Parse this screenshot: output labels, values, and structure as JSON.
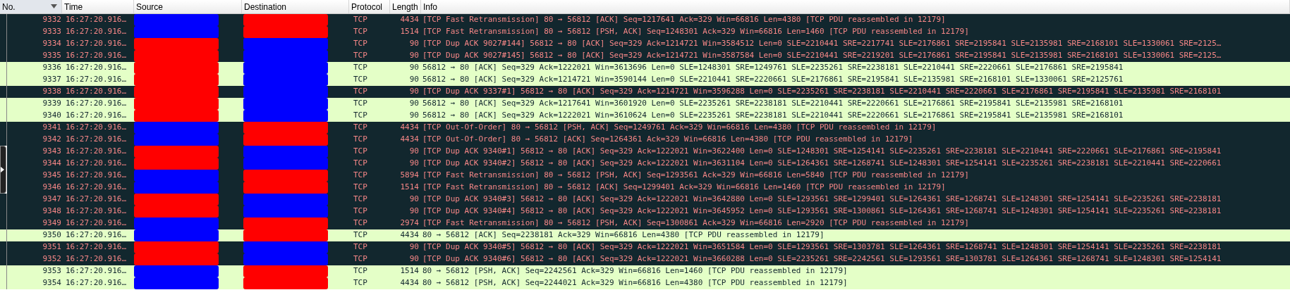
{
  "columns": [
    {
      "label": "No.",
      "sorted": true
    },
    {
      "label": "Time",
      "sorted": false
    },
    {
      "label": "Source",
      "sorted": false
    },
    {
      "label": "Destination",
      "sorted": false
    },
    {
      "label": "Protocol",
      "sorted": false
    },
    {
      "label": "Length",
      "sorted": false
    },
    {
      "label": "Info",
      "sorted": false
    }
  ],
  "rows": [
    {
      "no": "9332",
      "time": "16:27:20.916…",
      "source": {
        "color": "#0000ff"
      },
      "destination": {
        "color": "#ff0000"
      },
      "protocol": "TCP",
      "length": "4434",
      "info": "[TCP Fast Retransmission] 80 → 56812 [ACK] Seq=1217641 Ack=329 Win=66816 Len=4380 [TCP PDU reassembled in 12179]",
      "kind": "warning"
    },
    {
      "no": "9333",
      "time": "16:27:20.916…",
      "source": {
        "color": "#0000ff"
      },
      "destination": {
        "color": "#ff0000"
      },
      "protocol": "TCP",
      "length": "1514",
      "info": "[TCP Fast Retransmission] 80 → 56812 [PSH, ACK] Seq=1248301 Ack=329 Win=66816 Len=1460 [TCP PDU reassembled in 12179]",
      "kind": "warning"
    },
    {
      "no": "9334",
      "time": "16:27:20.916…",
      "source": {
        "color": "#ff0000"
      },
      "destination": {
        "color": "#0000ff"
      },
      "protocol": "TCP",
      "length": "90",
      "info": "[TCP Dup ACK 9027#144] 56812 → 80 [ACK] Seq=329 Ack=1214721 Win=3584512 Len=0 SLE=2210441 SRE=2217741 SLE=2176861 SRE=2195841 SLE=2135981 SRE=2168101 SLE=1330061 SRE=2125…",
      "kind": "warning"
    },
    {
      "no": "9335",
      "time": "16:27:20.916…",
      "source": {
        "color": "#ff0000"
      },
      "destination": {
        "color": "#0000ff"
      },
      "protocol": "TCP",
      "length": "90",
      "info": "[TCP Dup ACK 9027#145] 56812 → 80 [ACK] Seq=329 Ack=1214721 Win=3587584 Len=0 SLE=2210441 SRE=2219201 SLE=2176861 SRE=2195841 SLE=2135981 SRE=2168101 SLE=1330061 SRE=2125…",
      "kind": "warning"
    },
    {
      "no": "9336",
      "time": "16:27:20.916…",
      "source": {
        "color": "#ff0000"
      },
      "destination": {
        "color": "#0000ff"
      },
      "protocol": "TCP",
      "length": "90",
      "info": "56812 → 80 [ACK] Seq=329 Ack=1222021 Win=3613696 Len=0 SLE=1248301 SRE=1249761 SLE=2235261 SRE=2238181 SLE=2210441 SRE=2220661 SLE=2176861 SRE=2195841",
      "kind": "normal"
    },
    {
      "no": "9337",
      "time": "16:27:20.916…",
      "source": {
        "color": "#ff0000"
      },
      "destination": {
        "color": "#0000ff"
      },
      "protocol": "TCP",
      "length": "90",
      "info": "56812 → 80 [ACK] Seq=329 Ack=1214721 Win=3590144 Len=0 SLE=2210441 SRE=2220661 SLE=2176861 SRE=2195841 SLE=2135981 SRE=2168101 SLE=1330061 SRE=2125761",
      "kind": "normal"
    },
    {
      "no": "9338",
      "time": "16:27:20.916…",
      "source": {
        "color": "#ff0000"
      },
      "destination": {
        "color": "#0000ff"
      },
      "protocol": "TCP",
      "length": "90",
      "info": "[TCP Dup ACK 9337#1] 56812 → 80 [ACK] Seq=329 Ack=1214721 Win=3596288 Len=0 SLE=2235261 SRE=2238181 SLE=2210441 SRE=2220661 SLE=2176861 SRE=2195841 SLE=2135981 SRE=2168101",
      "kind": "warning"
    },
    {
      "no": "9339",
      "time": "16:27:20.916…",
      "source": {
        "color": "#ff0000"
      },
      "destination": {
        "color": "#0000ff"
      },
      "protocol": "TCP",
      "length": "90",
      "info": "56812 → 80 [ACK] Seq=329 Ack=1217641 Win=3601920 Len=0 SLE=2235261 SRE=2238181 SLE=2210441 SRE=2220661 SLE=2176861 SRE=2195841 SLE=2135981 SRE=2168101",
      "kind": "normal"
    },
    {
      "no": "9340",
      "time": "16:27:20.916…",
      "source": {
        "color": "#ff0000"
      },
      "destination": {
        "color": "#0000ff"
      },
      "protocol": "TCP",
      "length": "90",
      "info": "56812 → 80 [ACK] Seq=329 Ack=1222021 Win=3610624 Len=0 SLE=2235261 SRE=2238181 SLE=2210441 SRE=2220661 SLE=2176861 SRE=2195841 SLE=2135981 SRE=2168101",
      "kind": "normal"
    },
    {
      "no": "9341",
      "time": "16:27:20.916…",
      "source": {
        "color": "#0000ff"
      },
      "destination": {
        "color": "#ff0000"
      },
      "protocol": "TCP",
      "length": "4434",
      "info": "[TCP Out-Of-Order] 80 → 56812 [PSH, ACK] Seq=1249761 Ack=329 Win=66816 Len=4380 [TCP PDU reassembled in 12179]",
      "kind": "warning"
    },
    {
      "no": "9342",
      "time": "16:27:20.916…",
      "source": {
        "color": "#0000ff"
      },
      "destination": {
        "color": "#ff0000"
      },
      "protocol": "TCP",
      "length": "4434",
      "info": "[TCP Out-Of-Order] 80 → 56812 [ACK] Seq=1264361 Ack=329 Win=66816 Len=4380 [TCP PDU reassembled in 12179]",
      "kind": "warning"
    },
    {
      "no": "9343",
      "time": "16:27:20.916…",
      "source": {
        "color": "#ff0000"
      },
      "destination": {
        "color": "#0000ff"
      },
      "protocol": "TCP",
      "length": "90",
      "info": "[TCP Dup ACK 9340#1] 56812 → 80 [ACK] Seq=329 Ack=1222021 Win=3622400 Len=0 SLE=1248301 SRE=1254141 SLE=2235261 SRE=2238181 SLE=2210441 SRE=2220661 SLE=2176861 SRE=2195841",
      "kind": "warning"
    },
    {
      "no": "9344",
      "time": "16:27:20.916…",
      "source": {
        "color": "#ff0000"
      },
      "destination": {
        "color": "#0000ff"
      },
      "protocol": "TCP",
      "length": "90",
      "info": "[TCP Dup ACK 9340#2] 56812 → 80 [ACK] Seq=329 Ack=1222021 Win=3631104 Len=0 SLE=1264361 SRE=1268741 SLE=1248301 SRE=1254141 SLE=2235261 SRE=2238181 SLE=2210441 SRE=2220661",
      "kind": "warning"
    },
    {
      "no": "9345",
      "time": "16:27:20.916…",
      "source": {
        "color": "#0000ff"
      },
      "destination": {
        "color": "#ff0000"
      },
      "protocol": "TCP",
      "length": "5894",
      "info": "[TCP Fast Retransmission] 80 → 56812 [PSH, ACK] Seq=1293561 Ack=329 Win=66816 Len=5840 [TCP PDU reassembled in 12179]",
      "kind": "warning"
    },
    {
      "no": "9346",
      "time": "16:27:20.916…",
      "source": {
        "color": "#0000ff"
      },
      "destination": {
        "color": "#ff0000"
      },
      "protocol": "TCP",
      "length": "1514",
      "info": "[TCP Fast Retransmission] 80 → 56812 [ACK] Seq=1299401 Ack=329 Win=66816 Len=1460 [TCP PDU reassembled in 12179]",
      "kind": "warning"
    },
    {
      "no": "9347",
      "time": "16:27:20.916…",
      "source": {
        "color": "#ff0000"
      },
      "destination": {
        "color": "#0000ff"
      },
      "protocol": "TCP",
      "length": "90",
      "info": "[TCP Dup ACK 9340#3] 56812 → 80 [ACK] Seq=329 Ack=1222021 Win=3642880 Len=0 SLE=1293561 SRE=1299401 SLE=1264361 SRE=1268741 SLE=1248301 SRE=1254141 SLE=2235261 SRE=2238181",
      "kind": "warning"
    },
    {
      "no": "9348",
      "time": "16:27:20.916…",
      "source": {
        "color": "#ff0000"
      },
      "destination": {
        "color": "#0000ff"
      },
      "protocol": "TCP",
      "length": "90",
      "info": "[TCP Dup ACK 9340#4] 56812 → 80 [ACK] Seq=329 Ack=1222021 Win=3645952 Len=0 SLE=1293561 SRE=1300861 SLE=1264361 SRE=1268741 SLE=1248301 SRE=1254141 SLE=2235261 SRE=2238181",
      "kind": "warning"
    },
    {
      "no": "9349",
      "time": "16:27:20.916…",
      "source": {
        "color": "#0000ff"
      },
      "destination": {
        "color": "#ff0000"
      },
      "protocol": "TCP",
      "length": "2974",
      "info": "[TCP Fast Retransmission] 80 → 56812 [PSH, ACK] Seq=1300861 Ack=329 Win=66816 Len=2920 [TCP PDU reassembled in 12179]",
      "kind": "warning"
    },
    {
      "no": "9350",
      "time": "16:27:20.916…",
      "source": {
        "color": "#0000ff"
      },
      "destination": {
        "color": "#ff0000"
      },
      "protocol": "TCP",
      "length": "4434",
      "info": "80 → 56812 [ACK] Seq=2238181 Ack=329 Win=66816 Len=4380 [TCP PDU reassembled in 12179]",
      "kind": "normal"
    },
    {
      "no": "9351",
      "time": "16:27:20.916…",
      "source": {
        "color": "#ff0000"
      },
      "destination": {
        "color": "#0000ff"
      },
      "protocol": "TCP",
      "length": "90",
      "info": "[TCP Dup ACK 9340#5] 56812 → 80 [ACK] Seq=329 Ack=1222021 Win=3651584 Len=0 SLE=1293561 SRE=1303781 SLE=1264361 SRE=1268741 SLE=1248301 SRE=1254141 SLE=2235261 SRE=2238181",
      "kind": "warning"
    },
    {
      "no": "9352",
      "time": "16:27:20.916…",
      "source": {
        "color": "#ff0000"
      },
      "destination": {
        "color": "#0000ff"
      },
      "protocol": "TCP",
      "length": "90",
      "info": "[TCP Dup ACK 9340#6] 56812 → 80 [ACK] Seq=329 Ack=1222021 Win=3660288 Len=0 SLE=2235261 SRE=2242561 SLE=1293561 SRE=1303781 SLE=1264361 SRE=1268741 SLE=1248301 SRE=1254141",
      "kind": "warning"
    },
    {
      "no": "9353",
      "time": "16:27:20.916…",
      "source": {
        "color": "#0000ff"
      },
      "destination": {
        "color": "#ff0000"
      },
      "protocol": "TCP",
      "length": "1514",
      "info": "80 → 56812 [PSH, ACK] Seq=2242561 Ack=329 Win=66816 Len=1460 [TCP PDU reassembled in 12179]",
      "kind": "normal"
    },
    {
      "no": "9354",
      "time": "16:27:20.916…",
      "source": {
        "color": "#0000ff"
      },
      "destination": {
        "color": "#ff0000"
      },
      "protocol": "TCP",
      "length": "4434",
      "info": "80 → 56812 [PSH, ACK] Seq=2244021 Ack=329 Win=66816 Len=4380 [TCP PDU reassembled in 12179]",
      "kind": "normal"
    }
  ]
}
